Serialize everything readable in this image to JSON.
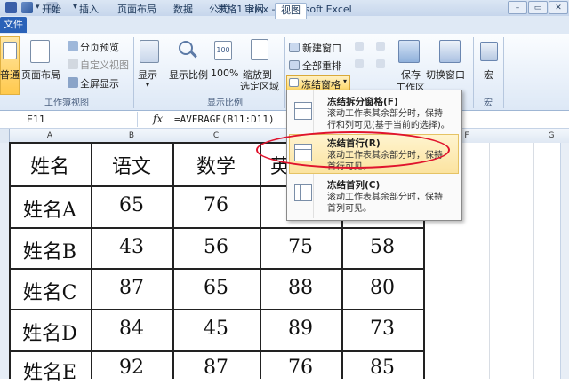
{
  "window": {
    "title": "表格1 .xlsx - Microsoft Excel",
    "quick_access_icons": [
      "save-icon",
      "undo-icon",
      "redo-icon",
      "customize-icon"
    ]
  },
  "tabs": [
    {
      "id": "file",
      "label": "文件"
    },
    {
      "id": "home",
      "label": "开始"
    },
    {
      "id": "insert",
      "label": "插入"
    },
    {
      "id": "layout",
      "label": "页面布局"
    },
    {
      "id": "data",
      "label": "数据"
    },
    {
      "id": "formula",
      "label": "公式"
    },
    {
      "id": "review",
      "label": "审阅"
    },
    {
      "id": "view",
      "label": "视图"
    }
  ],
  "ribbon": {
    "workbook_views": {
      "label": "工作簿视图",
      "normal": "普通",
      "page_layout": "页面布局",
      "page_break": "分页预览",
      "custom_views": "自定义视图",
      "full_screen": "全屏显示"
    },
    "show": {
      "label": "显示"
    },
    "zoom": {
      "label": "显示比例",
      "zoom_btn": "显示比例",
      "zoom100": "100%",
      "zoom_sel_1": "缩放到",
      "zoom_sel_2": "选定区域"
    },
    "window": {
      "new_window": "新建窗口",
      "arrange_all": "全部重排",
      "freeze_panes": "冻结窗格",
      "save_workspace_1": "保存",
      "save_workspace_2": "工作区",
      "switch_window": "切换窗口"
    },
    "macros": {
      "label": "宏",
      "btn": "宏"
    }
  },
  "formula_bar": {
    "name_box": "E11",
    "fx": "fx",
    "formula": "=AVERAGE(B11:D11)"
  },
  "columns": [
    "A",
    "B",
    "C",
    "F",
    "G"
  ],
  "table": {
    "header": [
      "姓名",
      "语文",
      "数学",
      "英"
    ],
    "rows": [
      [
        "姓名A",
        "65",
        "76",
        "",
        ""
      ],
      [
        "姓名B",
        "43",
        "56",
        "75",
        "58"
      ],
      [
        "姓名C",
        "87",
        "65",
        "88",
        "80"
      ],
      [
        "姓名D",
        "84",
        "45",
        "89",
        "73"
      ],
      [
        "姓名E",
        "92",
        "87",
        "76",
        "85"
      ]
    ]
  },
  "freeze_menu": [
    {
      "title": "冻结拆分窗格(F)",
      "desc1": "滚动工作表其余部分时，保持",
      "desc2": "行和列可见(基于当前的选择)。"
    },
    {
      "title": "冻结首行(R)",
      "desc1": "滚动工作表其余部分时，保持",
      "desc2": "首行可见。"
    },
    {
      "title": "冻结首列(C)",
      "desc1": "滚动工作表其余部分时，保持",
      "desc2": "首列可见。"
    }
  ],
  "colors": {
    "file_tab": "#2a62b8",
    "highlight_item": "#fbe3a0",
    "annotation_ring": "#e0142d"
  }
}
